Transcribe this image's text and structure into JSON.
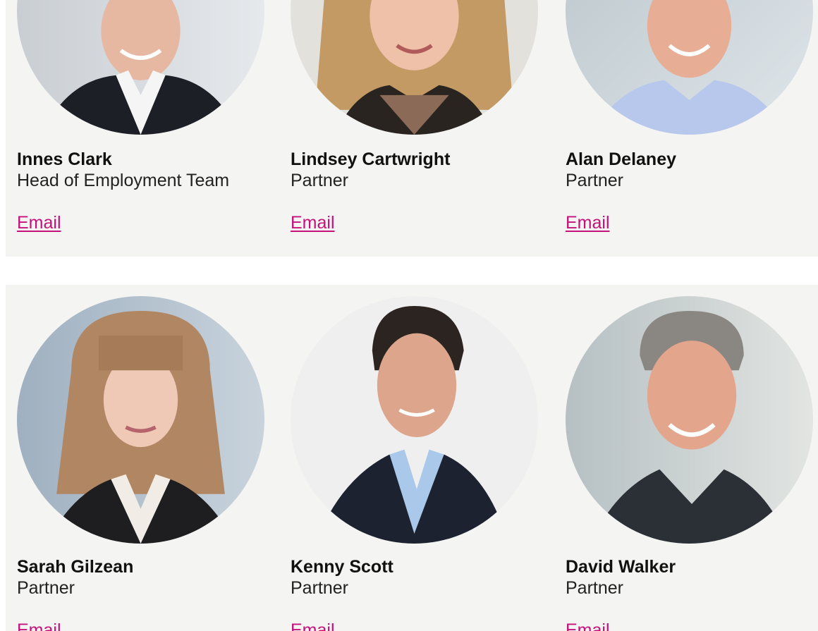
{
  "team_rows": [
    {
      "members": [
        {
          "name": "Innes Clark",
          "role": "Head of Employment Team",
          "email_label": "Email"
        },
        {
          "name": "Lindsey Cartwright",
          "role": "Partner",
          "email_label": "Email"
        },
        {
          "name": "Alan Delaney",
          "role": "Partner",
          "email_label": "Email"
        }
      ]
    },
    {
      "members": [
        {
          "name": "Sarah Gilzean",
          "role": "Partner",
          "email_label": "Email"
        },
        {
          "name": "Kenny Scott",
          "role": "Partner",
          "email_label": "Email"
        },
        {
          "name": "David Walker",
          "role": "Partner",
          "email_label": "Email"
        }
      ]
    }
  ],
  "colors": {
    "panel_background": "#f4f4f2",
    "email_link": "#c4127a",
    "name_text": "#111111"
  }
}
